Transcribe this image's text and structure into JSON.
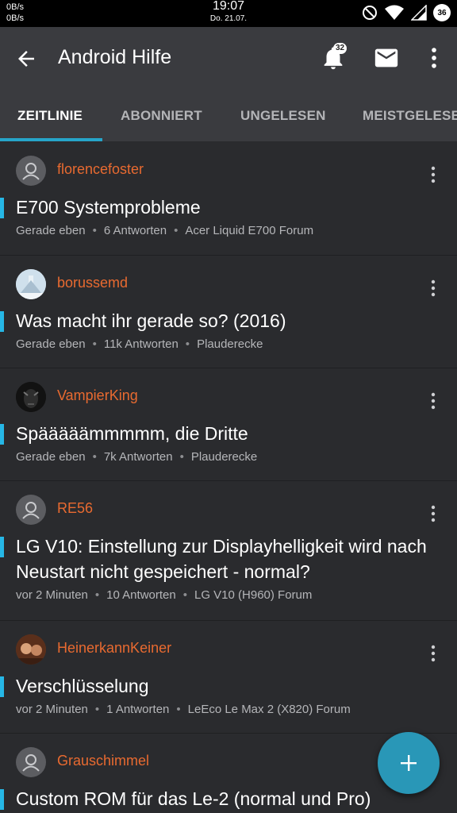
{
  "status": {
    "net_up": "0B/s",
    "net_down": "0B/s",
    "time": "19:07",
    "date": "Do. 21.07.",
    "battery": "36"
  },
  "appbar": {
    "title": "Android Hilfe",
    "notifications": "32"
  },
  "tabs": [
    {
      "label": "ZEITLINIE"
    },
    {
      "label": "ABONNIERT"
    },
    {
      "label": "UNGELESEN"
    },
    {
      "label": "MEISTGELESEN"
    }
  ],
  "threads": [
    {
      "author": "florencefoster",
      "title": "E700 Systemprobleme",
      "time": "Gerade eben",
      "replies": "6 Antworten",
      "forum": "Acer Liquid E700 Forum",
      "avatar": "default-avatar-icon"
    },
    {
      "author": "borussemd",
      "title": "Was macht ihr gerade so? (2016)",
      "time": "Gerade eben",
      "replies": "11k Antworten",
      "forum": "Plauderecke",
      "avatar": "snow-photo-avatar"
    },
    {
      "author": "VampierKing",
      "title": "Spääääämmmmm, die Dritte",
      "time": "Gerade eben",
      "replies": "7k Antworten",
      "forum": "Plauderecke",
      "avatar": "dark-face-avatar"
    },
    {
      "author": "RE56",
      "title": "LG V10: Einstellung zur Displayhelligkeit wird nach Neustart nicht gespeichert - normal?",
      "time": "vor 2 Minuten",
      "replies": "10 Antworten",
      "forum": "LG V10 (H960) Forum",
      "avatar": "default-avatar-icon"
    },
    {
      "author": "HeinerkannKeiner",
      "title": "Verschlüsselung",
      "time": "vor 2 Minuten",
      "replies": "1 Antworten",
      "forum": "LeEco Le Max 2 (X820) Forum",
      "avatar": "face-photo-avatar"
    },
    {
      "author": "Grauschimmel",
      "title": "Custom ROM für das Le-2 (normal und Pro)",
      "avatar": "default-avatar-icon"
    }
  ],
  "colors": {
    "accent": "#26a5c9",
    "author": "#e86a30",
    "fab": "#2997b7"
  }
}
